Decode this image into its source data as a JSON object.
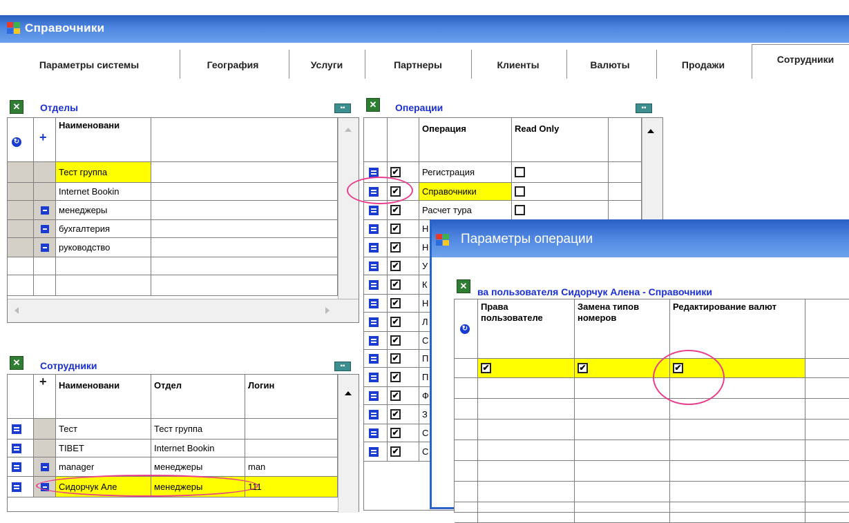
{
  "window": {
    "title": "Справочники"
  },
  "tabs": [
    "Параметры системы",
    "География",
    "Услуги",
    "Партнеры",
    "Клиенты",
    "Валюты",
    "Продажи",
    "Сотрудники"
  ],
  "departments": {
    "title": "Отделы",
    "header": "Наименовани",
    "rows": [
      "Тест группа",
      "Internet Bookin",
      "менеджеры",
      "бухгалтерия",
      "руководство"
    ]
  },
  "employees": {
    "title": "Сотрудники",
    "headers": {
      "name": "Наименовани",
      "dept": "Отдел",
      "login": "Логин"
    },
    "rows": [
      {
        "name": "Тест",
        "dept": "Тест группа",
        "login": ""
      },
      {
        "name": "TIBET",
        "dept": "Internet Bookin",
        "login": ""
      },
      {
        "name": "manager",
        "dept": "менеджеры",
        "login": "man"
      },
      {
        "name": "Сидорчук Але",
        "dept": "менеджеры",
        "login": "111"
      }
    ]
  },
  "operations": {
    "title": "Операции",
    "headers": {
      "op": "Операция",
      "ro": "Read Only"
    },
    "rows": [
      {
        "label": "Регистрация",
        "checked": true,
        "ro": false
      },
      {
        "label": "Справочники",
        "checked": true,
        "ro": false
      },
      {
        "label": "Расчет тура",
        "checked": true,
        "ro": false
      },
      {
        "label": "Н",
        "checked": true
      },
      {
        "label": "Н",
        "checked": true
      },
      {
        "label": "У",
        "checked": true
      },
      {
        "label": "К",
        "checked": true
      },
      {
        "label": "Н",
        "checked": true
      },
      {
        "label": "Л",
        "checked": true
      },
      {
        "label": "С",
        "checked": true
      },
      {
        "label": "П",
        "checked": true
      },
      {
        "label": "П",
        "checked": true
      },
      {
        "label": "Ф",
        "checked": true
      },
      {
        "label": "З",
        "checked": true
      },
      {
        "label": "С",
        "checked": true
      },
      {
        "label": "С",
        "checked": true
      }
    ]
  },
  "dialog": {
    "title": "Параметры операции",
    "grid_title": "ва пользователя Сидорчук Алена - Справочники",
    "headers": [
      "Права пользователе",
      "Замена типов номеров",
      "Редактирование валют"
    ]
  },
  "check_mark": "✔"
}
